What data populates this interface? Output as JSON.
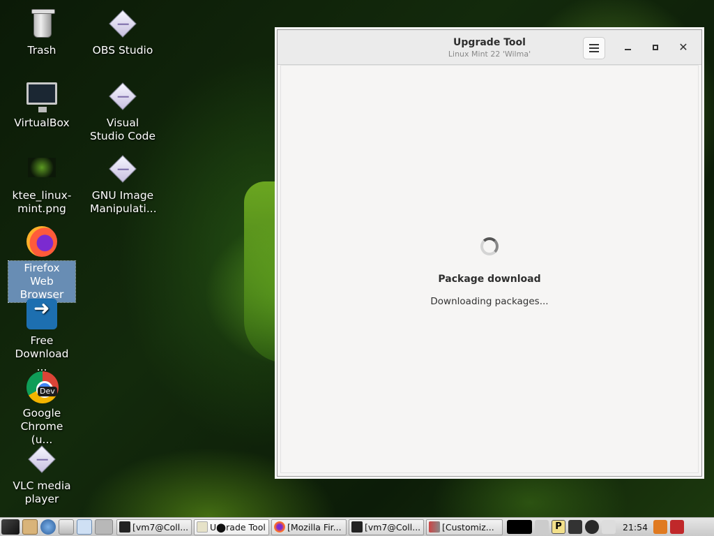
{
  "desktop": {
    "icons": [
      {
        "label": "Trash"
      },
      {
        "label": "OBS Studio"
      },
      {
        "label": "VirtualBox"
      },
      {
        "label": "Visual Studio Code"
      },
      {
        "label": "ktee_linux-mint.png"
      },
      {
        "label": "GNU Image Manipulati..."
      },
      {
        "label": "Firefox Web Browser"
      },
      {
        "label": "Free Download ..."
      },
      {
        "label": "Google Chrome (u..."
      },
      {
        "label": "VLC media player"
      }
    ],
    "chrome_badge": "Dev"
  },
  "window": {
    "title": "Upgrade Tool",
    "subtitle": "Linux Mint 22 'Wilma'",
    "status_title": "Package download",
    "status_text": "Downloading packages..."
  },
  "taskbar": {
    "tasks": [
      {
        "label": "[vm7@Coll..."
      },
      {
        "label": "U⬤rade Tool"
      },
      {
        "label": "[Mozilla Fir..."
      },
      {
        "label": "[vm7@Coll..."
      },
      {
        "label": "[Customiz..."
      }
    ],
    "clock": "21:54",
    "tray_p_label": "P"
  },
  "colors": {
    "accent_selection": "#7aa0d2",
    "desktop_green": "#6fc22a"
  }
}
